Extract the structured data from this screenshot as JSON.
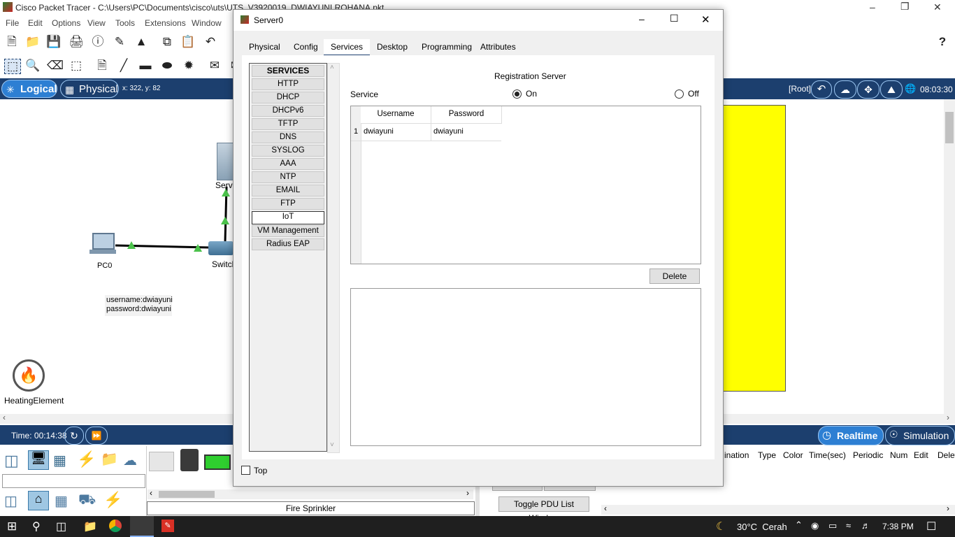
{
  "app": {
    "title": "Cisco Packet Tracer - C:\\Users\\PC\\Documents\\cisco\\uts\\UTS_V3920019_DWIAYUNI ROHANA.pkt",
    "menu": [
      "File",
      "Edit",
      "Options",
      "View",
      "Tools",
      "Extensions",
      "Window",
      "Help"
    ],
    "help_icon": "?"
  },
  "modebar": {
    "logical": "Logical",
    "physical": "Physical",
    "coords": "x: 322, y: 82",
    "root": "[Root]",
    "clock": "08:03:30"
  },
  "workspace": {
    "devices": {
      "pc0": "PC0",
      "server_partial": "Serv",
      "switch_partial": "Switch",
      "heating": "HeatingElement"
    },
    "note_username": "username:dwiayuni",
    "note_password": "password:dwiayuni",
    "yellow_color": "#ffff00"
  },
  "timebar": {
    "time": "Time: 00:14:38",
    "realtime": "Realtime",
    "simulation": "Simulation"
  },
  "bottom": {
    "device_label": "Fire Sprinkler",
    "toggle_pdu": "Toggle PDU List Window",
    "pdu_columns": [
      "ination",
      "Type",
      "Color",
      "Time(sec)",
      "Periodic",
      "Num",
      "Edit",
      "Delete"
    ]
  },
  "taskbar": {
    "weather": "30°C  Cerah",
    "time": "7:38 PM"
  },
  "dialog": {
    "title": "Server0",
    "tabs": [
      "Physical",
      "Config",
      "Services",
      "Desktop",
      "Programming",
      "Attributes"
    ],
    "active_tab": "Services",
    "services_header": "SERVICES",
    "services": [
      "HTTP",
      "DHCP",
      "DHCPv6",
      "TFTP",
      "DNS",
      "SYSLOG",
      "AAA",
      "NTP",
      "EMAIL",
      "FTP",
      "IoT",
      "VM Management",
      "Radius EAP"
    ],
    "selected_service": "IoT",
    "section_title": "Registration Server",
    "service_label": "Service",
    "radio_on": "On",
    "radio_off": "Off",
    "table_columns": [
      "Username",
      "Password"
    ],
    "table_rows": [
      {
        "num": "1",
        "username": "dwiayuni",
        "password": "dwiayuni"
      }
    ],
    "delete_button": "Delete",
    "top_checkbox": "Top"
  }
}
